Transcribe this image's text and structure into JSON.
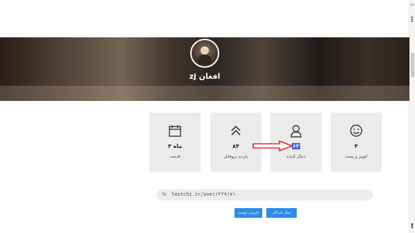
{
  "profile": {
    "username": "zj افغان"
  },
  "stats": [
    {
      "icon": "calendar-icon",
      "value": "۳ ماه",
      "label": "قدمت"
    },
    {
      "icon": "chevrons-up-icon",
      "value": "۸۴",
      "label": "بازدید پروفایل"
    },
    {
      "icon": "user-icon",
      "value": "۶۳",
      "label": "دنبال کننده"
    },
    {
      "icon": "smiley-icon",
      "value": "۴",
      "label": "کوییز و پست"
    }
  ],
  "profile_link": {
    "icon": "link-icon",
    "url": "testchi.ir/user/۲۲۹۱۷۱"
  },
  "buttons": {
    "add_friend": "افزودن دوست",
    "followers": "دنبال کنندگان"
  },
  "annotation": {
    "arrow_color": "#e8262a"
  },
  "colors": {
    "accent": "#2b8be8",
    "card_bg": "#ebebeb",
    "highlight": "#2b62e0"
  }
}
